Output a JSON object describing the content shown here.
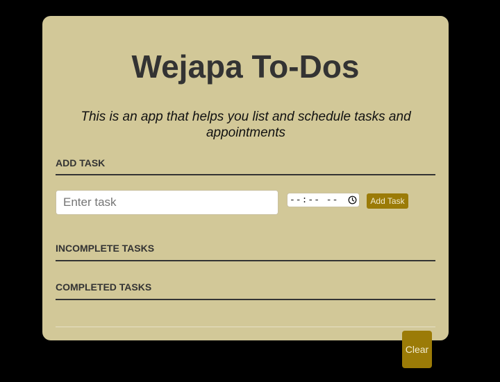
{
  "app": {
    "title": "Wejapa To-Dos",
    "subtitle": "This is an app that helps you list and schedule tasks and appointments"
  },
  "add_task": {
    "heading": "ADD TASK",
    "task_input": {
      "value": "",
      "placeholder": "Enter task"
    },
    "time_input": {
      "display": "--:-- --"
    },
    "button_label": "Add Task"
  },
  "incomplete": {
    "heading": "INCOMPLETE TASKS",
    "items": []
  },
  "completed": {
    "heading": "COMPLETED TASKS",
    "items": []
  },
  "clear_button_label": "Clear",
  "colors": {
    "page_background": "#000000",
    "card_background": "#d2c898",
    "accent_button": "#9b7b07",
    "heading_text": "#333333"
  },
  "icons": {
    "time_picker": "clock-icon"
  }
}
